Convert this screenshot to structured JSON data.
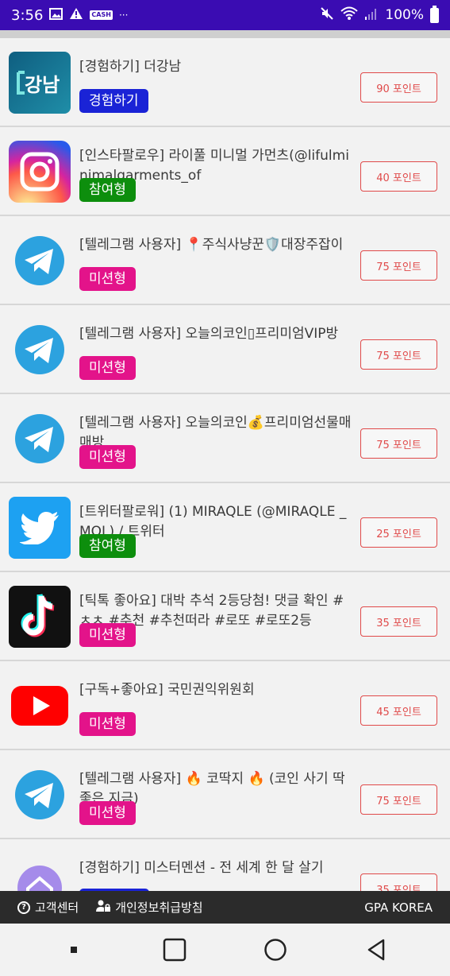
{
  "status_bar": {
    "time": "3:56",
    "cash_label": "CASH",
    "battery": "100%"
  },
  "items": [
    {
      "title": "[경험하기] 더강남",
      "tag": "경험하기",
      "tag_type": "exp",
      "points": "90 포인트",
      "icon": "gangnam-app-icon"
    },
    {
      "title": "[인스타팔로우] 라이풀 미니멀 가먼츠(@lifulminimalgarments_of",
      "tag": "참여형",
      "tag_type": "part",
      "points": "40 포인트",
      "icon": "instagram-icon"
    },
    {
      "title": "[텔레그램 사용자] 📍주식사냥꾼🛡️대장주잡이",
      "tag": "미션형",
      "tag_type": "mission",
      "points": "75 포인트",
      "icon": "telegram-icon"
    },
    {
      "title": "[텔레그램 사용자] 오늘의코인▯프리미엄VIP방",
      "tag": "미션형",
      "tag_type": "mission",
      "points": "75 포인트",
      "icon": "telegram-icon"
    },
    {
      "title": "[텔레그램 사용자] 오늘의코인💰프리미엄선물매매방",
      "tag": "미션형",
      "tag_type": "mission",
      "points": "75 포인트",
      "icon": "telegram-icon"
    },
    {
      "title": "[트위터팔로워] (1) MIRAQLE (@MIRAQLE _MQL) / 트위터",
      "tag": "참여형",
      "tag_type": "part",
      "points": "25 포인트",
      "icon": "twitter-icon"
    },
    {
      "title": "[틱톡 좋아요] 대박 추석 2등당첨! 댓글 확인 #ㅊㅊ #추천 #추천떠라 #로또 #로또2등",
      "tag": "미션형",
      "tag_type": "mission",
      "points": "35 포인트",
      "icon": "tiktok-icon"
    },
    {
      "title": "[구독+좋아요] 국민권익위원회",
      "tag": "미션형",
      "tag_type": "mission",
      "points": "45 포인트",
      "icon": "youtube-icon"
    },
    {
      "title": "[텔레그램 사용자] 🔥 코딱지 🔥 (코인 사기 딱 좋은 지금)",
      "tag": "미션형",
      "tag_type": "mission",
      "points": "75 포인트",
      "icon": "telegram-icon"
    },
    {
      "title": "[경험하기] 미스터멘션 - 전 세계 한 달 살기",
      "tag": "",
      "tag_type": "exp",
      "points": "35 포인트",
      "icon": "house-icon"
    }
  ],
  "footer": {
    "support": "고객센터",
    "privacy": "개인정보취급방침",
    "brand": "GPA KOREA"
  },
  "colors": {
    "status_bar": "#3a0cb2",
    "exp_tag": "#1a23d6",
    "part_tag": "#0d8e0d",
    "mission_tag": "#e3138a",
    "points_border": "#e04a4a",
    "footer": "#2b2b2b"
  }
}
